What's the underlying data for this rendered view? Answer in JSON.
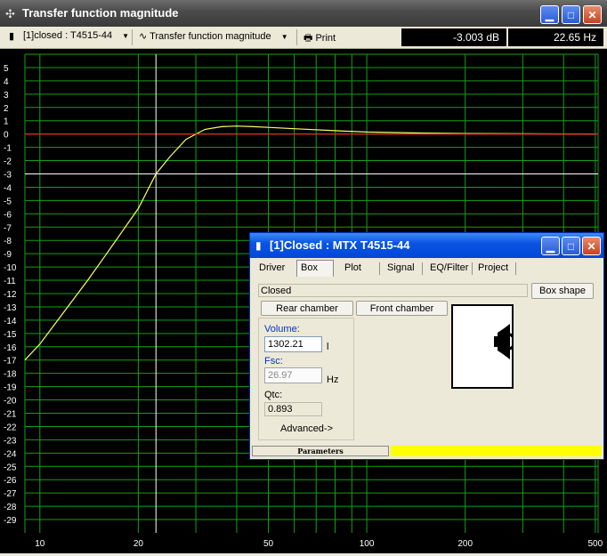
{
  "window": {
    "title": "Transfer function magnitude"
  },
  "toolbar": {
    "source_label": "[1]closed : T4515-44",
    "plot_label": "Transfer function magnitude",
    "print_label": "Print",
    "readout_db": "-3.003 dB",
    "readout_hz": "22.65 Hz"
  },
  "chart_data": {
    "type": "line",
    "title": "Transfer function magnitude",
    "x_scale": "log",
    "xlim": [
      9,
      510
    ],
    "ylim": [
      -30,
      6
    ],
    "x_ticks": [
      "10",
      "20",
      "50",
      "100",
      "200",
      "500"
    ],
    "y_ticks": [
      "5",
      "4",
      "3",
      "2",
      "1",
      "0",
      "-1",
      "-2",
      "-3",
      "-4",
      "-5",
      "-6",
      "-7",
      "-8",
      "-9",
      "-10",
      "-11",
      "-12",
      "-13",
      "-14",
      "-15",
      "-16",
      "-17",
      "-18",
      "-19",
      "-20",
      "-21",
      "-22",
      "-23",
      "-24",
      "-25",
      "-26",
      "-27",
      "-28",
      "-29"
    ],
    "grid": true,
    "cursor": {
      "x": 22.65,
      "y": -3.003
    },
    "series": [
      {
        "color": "#ffff60",
        "x": [
          9,
          10,
          12,
          14,
          16,
          18,
          20,
          22.65,
          25,
          28,
          32,
          36,
          40,
          45,
          50,
          60,
          80,
          100,
          150,
          200,
          300,
          500
        ],
        "y": [
          -17,
          -15.8,
          -13.2,
          -11,
          -9,
          -7.2,
          -5.6,
          -3.0,
          -1.7,
          -0.4,
          0.35,
          0.55,
          0.6,
          0.55,
          0.5,
          0.4,
          0.25,
          0.15,
          0.07,
          0.04,
          0.02,
          0.0
        ]
      },
      {
        "color": "#ff2020",
        "x": [
          9,
          510
        ],
        "y": [
          0,
          0
        ]
      }
    ]
  },
  "child": {
    "title": "[1]Closed : MTX T4515-44",
    "tabs": [
      "Driver",
      "Box",
      "Plot",
      "Signal",
      "EQ/Filter",
      "Project"
    ],
    "box_type": "Closed",
    "box_shape_btn": "Box shape",
    "rear_btn": "Rear chamber",
    "front_btn": "Front chamber",
    "volume_label": "Volume:",
    "volume_value": "1302.21",
    "volume_unit": "l",
    "fsc_label": "Fsc:",
    "fsc_value": "26.97",
    "fsc_unit": "Hz",
    "qtc_label": "Qtc:",
    "qtc_value": "0.893",
    "advanced_label": "Advanced->",
    "status_label": "Parameters",
    "status_color": "#ffff00"
  }
}
